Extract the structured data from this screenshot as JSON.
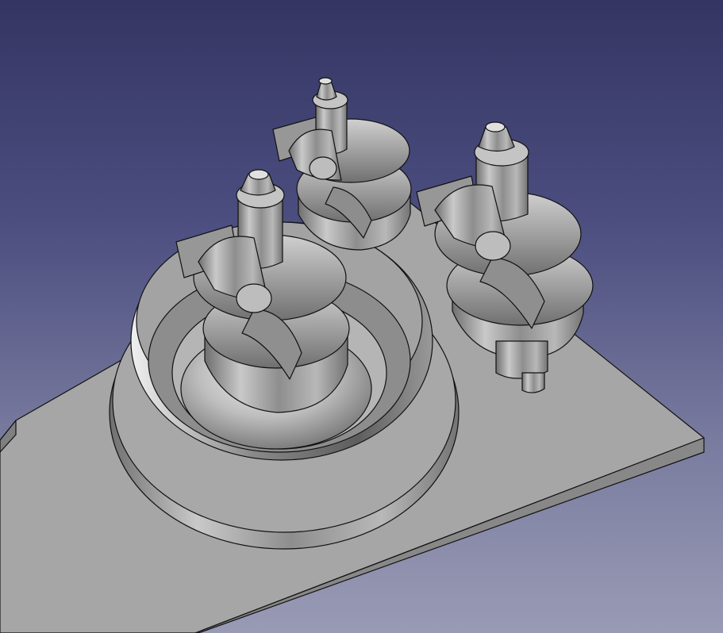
{
  "viewport": {
    "background_top": "#343563",
    "background_bottom": "#999bb5",
    "model_color": "#a7a7a7"
  }
}
